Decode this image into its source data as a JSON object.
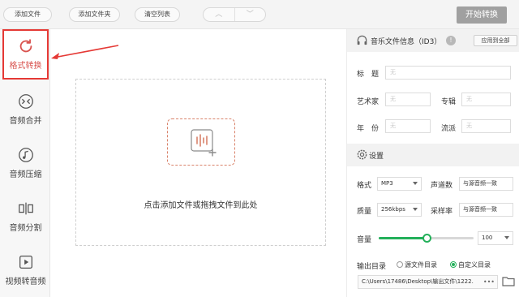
{
  "toolbar": {
    "add_file": "添加文件",
    "add_folder": "添加文件夹",
    "clear_list": "清空列表",
    "move_up": "︿",
    "move_down": "﹀",
    "start_convert": "开始转换"
  },
  "sidebar": {
    "items": [
      {
        "label": "格式转换",
        "icon": "refresh-icon",
        "active": true
      },
      {
        "label": "音频合并",
        "icon": "merge-icon",
        "active": false
      },
      {
        "label": "音频压缩",
        "icon": "music-note-icon",
        "active": false
      },
      {
        "label": "音频分割",
        "icon": "split-icon",
        "active": false
      },
      {
        "label": "视频转音频",
        "icon": "play-icon",
        "active": false
      }
    ]
  },
  "dropzone": {
    "text": "点击添加文件或拖拽文件到此处",
    "icon": "add-audio-icon"
  },
  "id3": {
    "title": "音乐文件信息（ID3）",
    "info_icon": "!",
    "apply_all": "应用到全部",
    "fields": {
      "title_label": "标　题",
      "title_placeholder": "无",
      "artist_label": "艺术家",
      "artist_placeholder": "无",
      "album_label": "专辑",
      "album_placeholder": "无",
      "year_label": "年　份",
      "year_placeholder": "无",
      "genre_label": "流派",
      "genre_placeholder": "无"
    }
  },
  "settings": {
    "title": "设置",
    "format_label": "格式",
    "format_value": "MP3",
    "channels_label": "声道数",
    "channels_value": "与源音频一致",
    "quality_label": "质量",
    "quality_value": "256kbps",
    "samplerate_label": "采样率",
    "samplerate_value": "与源音频一致",
    "volume_label": "音量",
    "volume_value": "100",
    "volume_fraction": 0.5,
    "output_label": "输出目录",
    "output_source": "源文件目录",
    "output_custom": "自定义目录",
    "output_selected": "custom",
    "output_path": "C:\\Users\\17486\\Desktop\\输出文件\\1222.",
    "browse_dots": "•••"
  },
  "colors": {
    "accent_green": "#23b05a",
    "active_red": "#e53935",
    "start_btn": "#a0a0a0"
  }
}
